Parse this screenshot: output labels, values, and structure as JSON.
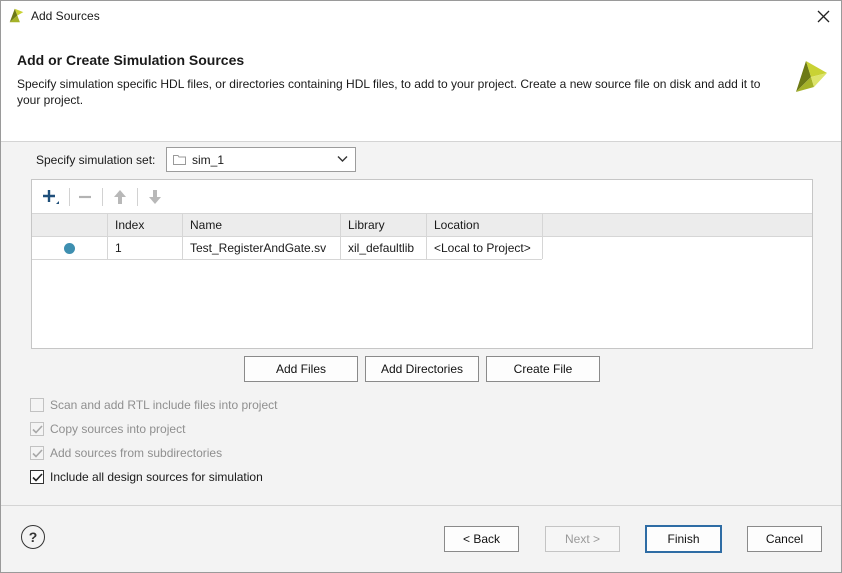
{
  "window": {
    "title": "Add Sources"
  },
  "header": {
    "heading": "Add or Create Simulation Sources",
    "description": "Specify simulation specific HDL files, or directories containing HDL files, to add to your project. Create a new source file on disk and add it to your project."
  },
  "simset": {
    "label": "Specify simulation set:",
    "value": "sim_1"
  },
  "table": {
    "columns": [
      "Index",
      "Name",
      "Library",
      "Location"
    ],
    "rows": [
      {
        "index": "1",
        "name": "Test_RegisterAndGate.sv",
        "library": "xil_defaultlib",
        "location": "<Local to Project>"
      }
    ]
  },
  "actions": {
    "add_files": "Add Files",
    "add_directories": "Add Directories",
    "create_file": "Create File"
  },
  "options": [
    {
      "label": "Scan and add RTL include files into project",
      "checked": false,
      "enabled": false
    },
    {
      "label": "Copy sources into project",
      "checked": true,
      "enabled": false
    },
    {
      "label": "Add sources from subdirectories",
      "checked": true,
      "enabled": false
    },
    {
      "label": "Include all design sources for simulation",
      "checked": true,
      "enabled": true
    }
  ],
  "footer": {
    "help": "?",
    "back": "< Back",
    "next": "Next >",
    "finish": "Finish",
    "cancel": "Cancel"
  },
  "colors": {
    "accent": "#2e6ca4",
    "status_dot": "#3e8fb0",
    "logo_yellow": "#c9d234",
    "logo_dark": "#6d7a16"
  }
}
